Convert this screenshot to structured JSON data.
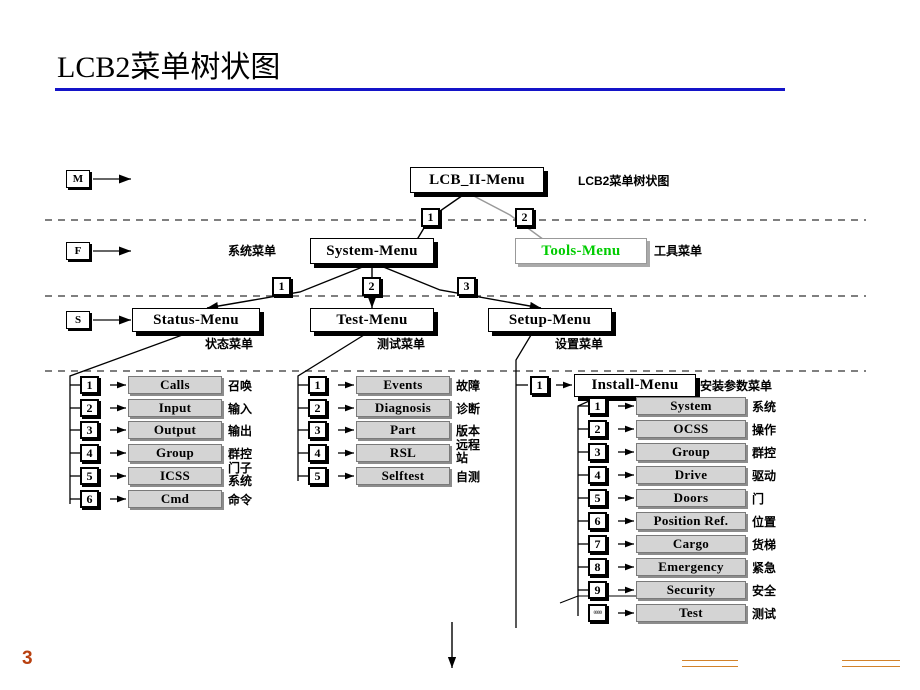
{
  "slide": {
    "title": "LCB2菜单树状图",
    "page_number": "3",
    "diagram_caption": "LCB2菜单树状图"
  },
  "level_markers": [
    {
      "id": "m",
      "label": "M"
    },
    {
      "id": "f",
      "label": "F"
    },
    {
      "id": "s",
      "label": "S"
    }
  ],
  "root": {
    "label": "LCB_II-Menu"
  },
  "level2": {
    "system": {
      "label": "System-Menu",
      "cn": "系统菜单",
      "badge": "1"
    },
    "tools": {
      "label": "Tools-Menu",
      "cn": "工具菜单",
      "badge": "2"
    }
  },
  "level3": {
    "status": {
      "label": "Status-Menu",
      "cn": "状态菜单",
      "badge": "1"
    },
    "test": {
      "label": "Test-Menu",
      "cn": "测试菜单",
      "badge": "2"
    },
    "setup": {
      "label": "Setup-Menu",
      "cn": "设置菜单",
      "badge": "3"
    }
  },
  "install": {
    "label": "Install-Menu",
    "cn": "安装参数菜单",
    "badge": "1"
  },
  "status_items": [
    {
      "badge": "1",
      "label": "Calls",
      "cn": "召唤"
    },
    {
      "badge": "2",
      "label": "Input",
      "cn": "输入"
    },
    {
      "badge": "3",
      "label": "Output",
      "cn": "输出"
    },
    {
      "badge": "4",
      "label": "Group",
      "cn": "群控"
    },
    {
      "badge": "5",
      "label": "ICSS",
      "cn": "门子系统"
    },
    {
      "badge": "6",
      "label": "Cmd",
      "cn": "命令"
    }
  ],
  "test_items": [
    {
      "badge": "1",
      "label": "Events",
      "cn": "故障"
    },
    {
      "badge": "2",
      "label": "Diagnosis",
      "cn": "诊断"
    },
    {
      "badge": "3",
      "label": "Part",
      "cn": "版本"
    },
    {
      "badge": "4",
      "label": "RSL",
      "cn": "远程站"
    },
    {
      "badge": "5",
      "label": "Selftest",
      "cn": "自测"
    }
  ],
  "install_items": [
    {
      "badge": "1",
      "label": "System",
      "cn": "系统"
    },
    {
      "badge": "2",
      "label": "OCSS",
      "cn": "操作"
    },
    {
      "badge": "3",
      "label": "Group",
      "cn": "群控"
    },
    {
      "badge": "4",
      "label": "Drive",
      "cn": "驱动"
    },
    {
      "badge": "5",
      "label": "Doors",
      "cn": "门"
    },
    {
      "badge": "6",
      "label": "Position Ref.",
      "cn": "位置"
    },
    {
      "badge": "7",
      "label": "Cargo",
      "cn": "货梯"
    },
    {
      "badge": "8",
      "label": "Emergency",
      "cn": "紧急"
    },
    {
      "badge": "9",
      "label": "Security",
      "cn": "安全"
    },
    {
      "badge": "0000",
      "label": "Test",
      "cn": "测试"
    }
  ],
  "colors": {
    "title_rule": "#1414c8",
    "page_number": "#b8400f",
    "footer_rule": "#d2822a",
    "tools_text": "#00cc00",
    "leaf_fill": "#d4d4d4"
  }
}
